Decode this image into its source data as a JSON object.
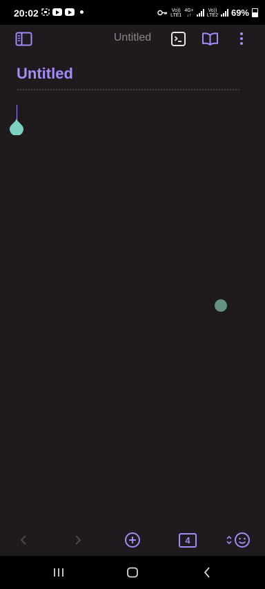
{
  "status_bar": {
    "time": "20:02",
    "battery": "69%",
    "net1_top": "Vo))",
    "net1_bottom": "LTE1",
    "net2_top": "4G+",
    "net2_bottom": "↓↑",
    "net3_top": "Vo))",
    "net3_bottom": "LTE2"
  },
  "header": {
    "title": "Untitled",
    "icons": [
      "sidebar-toggle-icon",
      "terminal-icon",
      "book-open-icon",
      "more-vertical-icon"
    ]
  },
  "note": {
    "title": "Untitled"
  },
  "toolbar": {
    "tab_count": "4",
    "icons": [
      "chevron-left-icon",
      "chevron-right-icon",
      "plus-circle-icon",
      "tab-count",
      "sort-icon",
      "smile-icon"
    ]
  },
  "navigation": {
    "icons": [
      "recent-apps-icon",
      "home-icon",
      "back-icon"
    ]
  },
  "colors": {
    "background": "#1e1a1d",
    "accent": "#a68af9",
    "cursor_handle": "#7ed2c4",
    "muted": "#8a8690"
  }
}
